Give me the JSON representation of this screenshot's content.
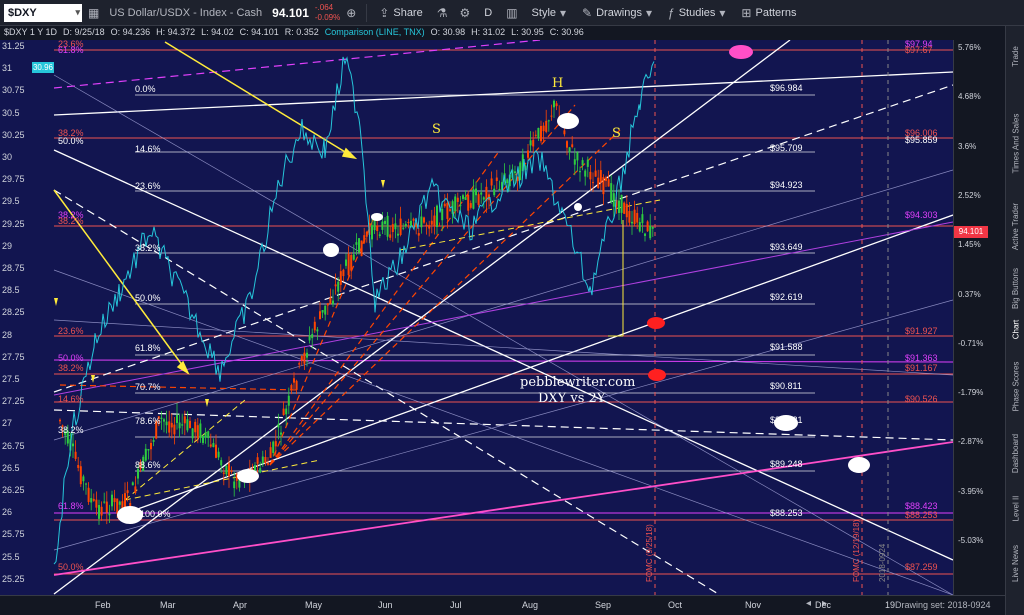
{
  "toolbar": {
    "symbol": "$DXY",
    "symbol_name": "US Dollar/USDX - Index - Cash",
    "price": "94.101",
    "change": "-.064",
    "change_pct": "-0.09%",
    "share": "Share",
    "interval": "D",
    "style": "Style",
    "drawings": "Drawings",
    "studies": "Studies",
    "patterns": "Patterns"
  },
  "infoline": {
    "ticker": "$DXY 1 Y 1D",
    "date": "D: 9/25/18",
    "open": "O: 94.236",
    "high": "H: 94.372",
    "low": "L: 94.02",
    "close": "C: 94.101",
    "range": "R: 0.352",
    "comparison": "Comparison (LINE, TNX)",
    "cmp_open": "O: 30.98",
    "cmp_high": "H: 31.02",
    "cmp_low": "L: 30.95",
    "cmp_close": "C: 30.96"
  },
  "left_axis": [
    "31.25",
    "31",
    "30.75",
    "30.5",
    "30.25",
    "30",
    "29.75",
    "29.5",
    "29.25",
    "29",
    "28.75",
    "28.5",
    "28.25",
    "28",
    "27.75",
    "27.5",
    "27.25",
    "27",
    "26.75",
    "26.5",
    "26.25",
    "26",
    "25.75",
    "25.5",
    "25.25"
  ],
  "left_current": "30.96",
  "right_axis": [
    "5.76%",
    "4.68%",
    "3.6%",
    "2.52%",
    "1.45%",
    "0.37%",
    "-0.71%",
    "-1.79%",
    "-2.87%",
    "-3.95%",
    "-5.03%"
  ],
  "right_current": "94.101",
  "bottom_axis": [
    "Feb",
    "Mar",
    "Apr",
    "May",
    "Jun",
    "Jul",
    "Aug",
    "Sep",
    "Oct",
    "Nov",
    "Dec",
    "19"
  ],
  "drawing_set": "Drawing set: 2018-0924",
  "side_tabs": [
    "Trade",
    "Times And Sales",
    "Active Trader",
    "Big Buttons",
    "Chart",
    "Phase Scores",
    "Dashboard",
    "Level II",
    "Live News"
  ],
  "fib_inner": {
    "f0": "0.0%",
    "f146": "14.6%",
    "f236": "23.6%",
    "f382": "38.2%",
    "f50": "50.0%",
    "f618": "61.8%",
    "f707": "70.7%",
    "f786": "78.6%",
    "f886": "88.6%",
    "f100": "100.0%"
  },
  "fib_inner_prices": [
    "$96.984",
    "$95.709",
    "$94.923",
    "$93.649",
    "$92.619",
    "$91.588",
    "$90.811",
    "$89.921",
    "$89.248",
    "$88.253"
  ],
  "fib_right": {
    "p1": "$97.94",
    "p1b": "$97.67",
    "p2": "$96.006",
    "p2b": "$95.859",
    "p3": "$94.303",
    "p4": "$91.927",
    "p5": "$91.363",
    "p5b": "$91.167",
    "p6": "$90.526",
    "p7": "$88.423",
    "p7b": "$88.253",
    "p8": "$87.259"
  },
  "fib_left": {
    "l1": "23.6%",
    "l1b": "61.8%",
    "l2": "38.2%",
    "l2b": "50.0%",
    "l3": "38.2%",
    "l3b": "38.2%",
    "l4": "23.6%",
    "l5": "50.0%",
    "l5b": "38.2%",
    "l6": "14.6%",
    "l7": "38.2%",
    "l8": "61.8%",
    "l9": "50.0%"
  },
  "watermark": [
    "pebblewriter.com",
    "DXY vs 2Y"
  ],
  "waves": {
    "s1": "S",
    "h": "H",
    "s2": "S"
  },
  "vlines": {
    "fomc1": "FOMC (9/25/18)",
    "fomc2": "FOMC (12/19/18)",
    "year": "2018-0924"
  },
  "colors": {
    "bg": "#121550",
    "up": "#2ecc40",
    "down": "#ff4500",
    "cmp": "#26c6da",
    "fib_red": "#ef5350",
    "fib_mag": "#e040fb",
    "trend": "#ffeb3b"
  }
}
